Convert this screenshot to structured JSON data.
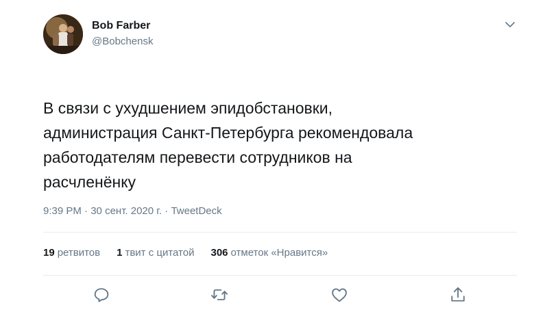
{
  "author": {
    "name": "Bob Farber",
    "handle": "@Bobchensk"
  },
  "tweet": {
    "lines": [
      "В связи с ухудшением эпидобстановки,",
      "администрация Санкт-Петербурга рекомендовала",
      "работодателям перевести сотрудников на",
      "расчленёнку"
    ]
  },
  "meta": {
    "time": "9:39 PM",
    "sep1": " · ",
    "date": "30 сент. 2020 г.",
    "sep2": " · ",
    "source": "TweetDeck"
  },
  "stats": {
    "retweets_count": "19",
    "retweets_label": "ретвитов",
    "quotes_count": "1",
    "quotes_label": "твит с цитатой",
    "likes_count": "306",
    "likes_label": "отметок «Нравится»"
  },
  "icons": {
    "menu": "chevron-down-icon",
    "reply": "reply-icon",
    "retweet": "retweet-icon",
    "like": "heart-icon",
    "share": "share-icon"
  },
  "colors": {
    "text": "#14171a",
    "secondary": "#657786",
    "icon": "#657786",
    "divider": "#e6ecf0"
  }
}
